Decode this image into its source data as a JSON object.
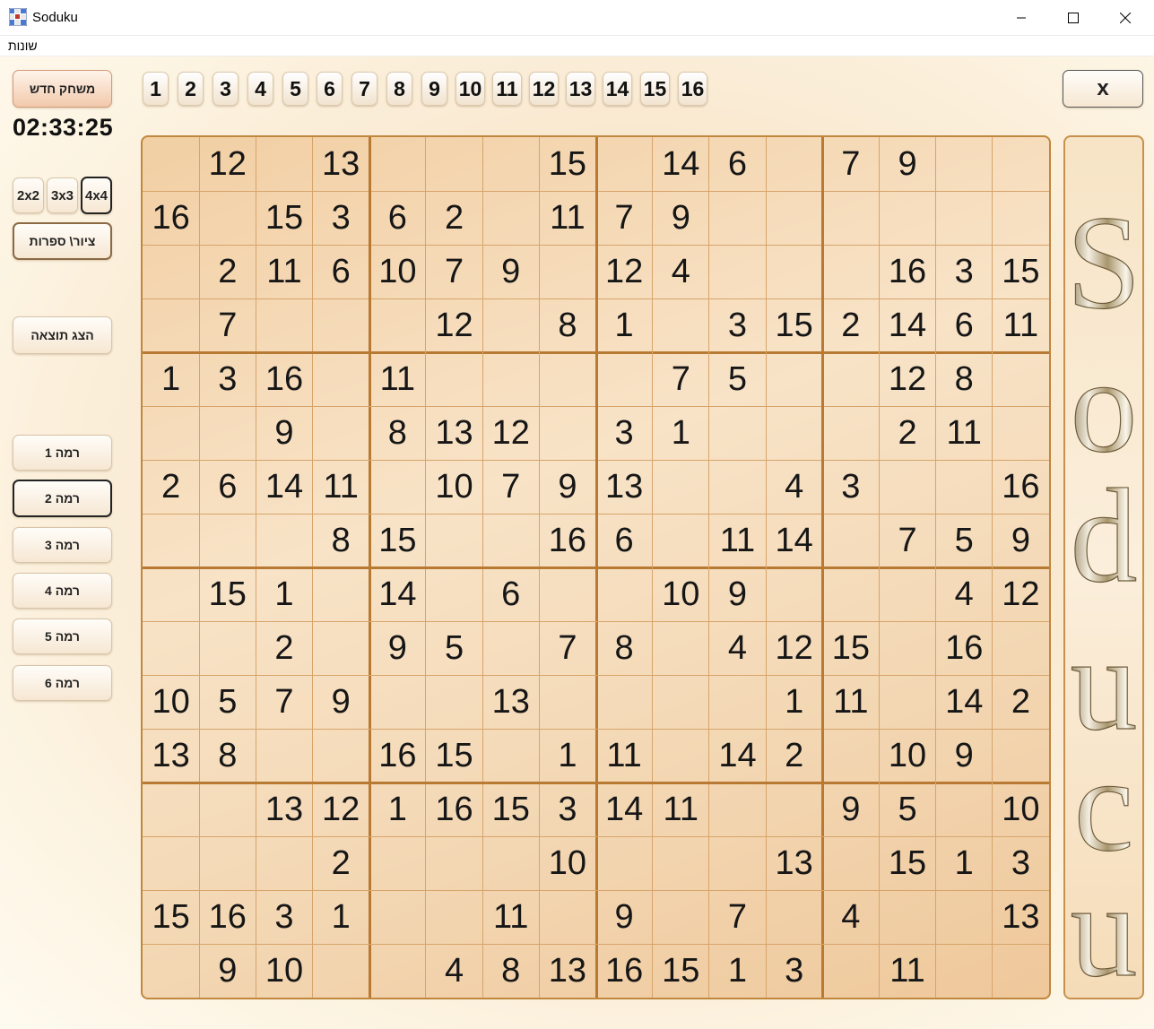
{
  "window": {
    "title": "Soduku",
    "minimize_icon": "minimize-icon",
    "maximize_icon": "maximize-icon",
    "close_icon": "close-icon"
  },
  "menu": {
    "items": [
      "שונות"
    ]
  },
  "left_panel": {
    "new_game_label": "משחק חדש",
    "timer": "02:33:25",
    "size_options": [
      {
        "label": "2x2",
        "selected": false
      },
      {
        "label": "3x3",
        "selected": false
      },
      {
        "label": "4x4",
        "selected": true
      }
    ],
    "mode_toggle_label": "ציור\\ ספרות",
    "show_result_label": "הצג תוצאה",
    "levels": [
      {
        "label": "רמה 1",
        "selected": false
      },
      {
        "label": "רמה 2",
        "selected": true
      },
      {
        "label": "רמה 3",
        "selected": false
      },
      {
        "label": "רמה 4",
        "selected": false
      },
      {
        "label": "רמה 5",
        "selected": false
      },
      {
        "label": "רמה 6",
        "selected": false
      }
    ]
  },
  "palette": [
    "1",
    "2",
    "3",
    "4",
    "5",
    "6",
    "7",
    "8",
    "9",
    "10",
    "11",
    "12",
    "13",
    "14",
    "15",
    "16"
  ],
  "close_button_label": "x",
  "logo_text": "Soducu",
  "colors": {
    "board_line": "#d7a46b",
    "board_box_line": "#b87a33",
    "accent": "#c0873f"
  },
  "board": {
    "size": 16,
    "box": 4,
    "rows": [
      [
        "",
        "12",
        "",
        "13",
        "",
        "",
        "",
        "15",
        "",
        "14",
        "6",
        "",
        "7",
        "9",
        "",
        ""
      ],
      [
        "16",
        "",
        "15",
        "3",
        "6",
        "2",
        "",
        "11",
        "7",
        "9",
        "",
        "",
        "",
        "",
        "",
        ""
      ],
      [
        "",
        "2",
        "11",
        "6",
        "10",
        "7",
        "9",
        "",
        "12",
        "4",
        "",
        "",
        "",
        "16",
        "3",
        "15"
      ],
      [
        "",
        "7",
        "",
        "",
        "",
        "12",
        "",
        "8",
        "1",
        "",
        "3",
        "15",
        "2",
        "14",
        "6",
        "11"
      ],
      [
        "1",
        "3",
        "16",
        "",
        "11",
        "",
        "",
        "",
        "",
        "7",
        "5",
        "",
        "",
        "12",
        "8",
        ""
      ],
      [
        "",
        "",
        "9",
        "",
        "8",
        "13",
        "12",
        "",
        "3",
        "1",
        "",
        "",
        "",
        "2",
        "11",
        ""
      ],
      [
        "2",
        "6",
        "14",
        "11",
        "",
        "10",
        "7",
        "9",
        "13",
        "",
        "",
        "4",
        "3",
        "",
        "",
        "16"
      ],
      [
        "",
        "",
        "",
        "8",
        "15",
        "",
        "",
        "16",
        "6",
        "",
        "11",
        "14",
        "",
        "7",
        "5",
        "9"
      ],
      [
        "",
        "15",
        "1",
        "",
        "14",
        "",
        "6",
        "",
        "",
        "10",
        "9",
        "",
        "",
        "",
        "4",
        "12"
      ],
      [
        "",
        "",
        "2",
        "",
        "9",
        "5",
        "",
        "7",
        "8",
        "",
        "4",
        "12",
        "15",
        "",
        "16",
        ""
      ],
      [
        "10",
        "5",
        "7",
        "9",
        "",
        "",
        "13",
        "",
        "",
        "",
        "",
        "1",
        "11",
        "",
        "14",
        "2"
      ],
      [
        "13",
        "8",
        "",
        "",
        "16",
        "15",
        "",
        "1",
        "11",
        "",
        "14",
        "2",
        "",
        "10",
        "9",
        ""
      ],
      [
        "",
        "",
        "13",
        "12",
        "1",
        "16",
        "15",
        "3",
        "14",
        "11",
        "",
        "",
        "9",
        "5",
        "",
        "10"
      ],
      [
        "",
        "",
        "",
        "2",
        "",
        "",
        "",
        "10",
        "",
        "",
        "",
        "13",
        "",
        "15",
        "1",
        "3"
      ],
      [
        "15",
        "16",
        "3",
        "1",
        "",
        "",
        "11",
        "",
        "9",
        "",
        "7",
        "",
        "4",
        "",
        "",
        "13"
      ],
      [
        "",
        "9",
        "10",
        "",
        "",
        "4",
        "8",
        "13",
        "16",
        "15",
        "1",
        "3",
        "",
        "11",
        "",
        ""
      ]
    ]
  }
}
